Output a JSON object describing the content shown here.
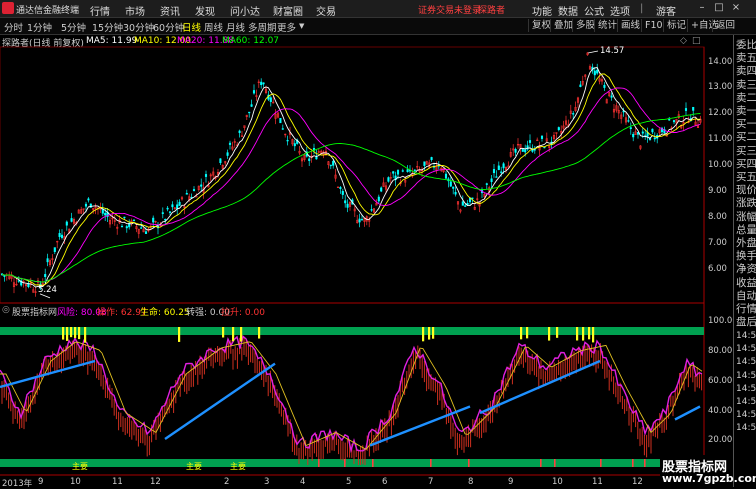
{
  "app": {
    "title": "通达信金融终端"
  },
  "menu": [
    "行情",
    "市场",
    "资讯",
    "发现",
    "问小达",
    "财富圈",
    "交易"
  ],
  "warning": {
    "text": "证券交易未登录",
    "login": "探路者"
  },
  "right_menu": [
    "功能",
    "数据",
    "公式",
    "选项"
  ],
  "user": "游客",
  "periods": [
    "分时",
    "1分钟",
    "5分钟",
    "15分钟",
    "30分钟",
    "60分钟",
    "日线",
    "周线",
    "月线",
    "多周期",
    "更多"
  ],
  "active_period": "日线",
  "tools": [
    "复权",
    "叠加",
    "多股",
    "统计",
    "画线",
    "F10",
    "标记",
    "+自选",
    "返回"
  ],
  "main_header": {
    "name": "探路者(日线 前复权)",
    "ma5": "MA5: 11.99",
    "ma10": "MA10: 12.00",
    "ma20": "MA20: 11.88",
    "ma60": "MA60: 12.07"
  },
  "price_axis": [
    "14.00",
    "13.00",
    "12.00",
    "11.00",
    "10.00",
    "9.00",
    "8.00",
    "7.00",
    "6.00"
  ],
  "high_label": "14.57",
  "low_label": "5.24",
  "indicator_header": {
    "name": "股票指标网",
    "risk": "风险: 80.08",
    "operate": "操作: 62.97",
    "life": "生命: 60.25",
    "turn": "转强: 0.00",
    "pull": "拉升: 0.00"
  },
  "ind_axis": [
    "100.00",
    "80.00",
    "60.00",
    "40.00",
    "20.00"
  ],
  "ind_tags": [
    "主要",
    "主要",
    "主要"
  ],
  "x_axis": [
    "2013年",
    "9",
    "10",
    "11",
    "12",
    "2",
    "3",
    "4",
    "5",
    "6",
    "7",
    "8",
    "9",
    "10",
    "11",
    "12"
  ],
  "right_panel": [
    "委比",
    "卖五",
    "卖四",
    "卖三",
    "卖二",
    "卖一",
    "买一",
    "买二",
    "买三",
    "买四",
    "买五",
    "现价",
    "涨跌",
    "涨幅",
    "总量",
    "外盘",
    "换手",
    "净资",
    "收益",
    "自动",
    "行情",
    "盘后",
    "14:50",
    "14:50",
    "14:50",
    "14:50",
    "14:50",
    "14:50",
    "14:50",
    "14:50"
  ],
  "watermark": {
    "line1": "股票指标网",
    "line2": "www.7gpzb.com"
  },
  "colors": {
    "up": "#ff3232",
    "down": "#00ffff",
    "ma5": "#ffffff",
    "ma10": "#ffff00",
    "ma20": "#ff00ff",
    "ma60": "#00ff00",
    "band": "#00a050",
    "blue": "#1e90ff"
  }
}
